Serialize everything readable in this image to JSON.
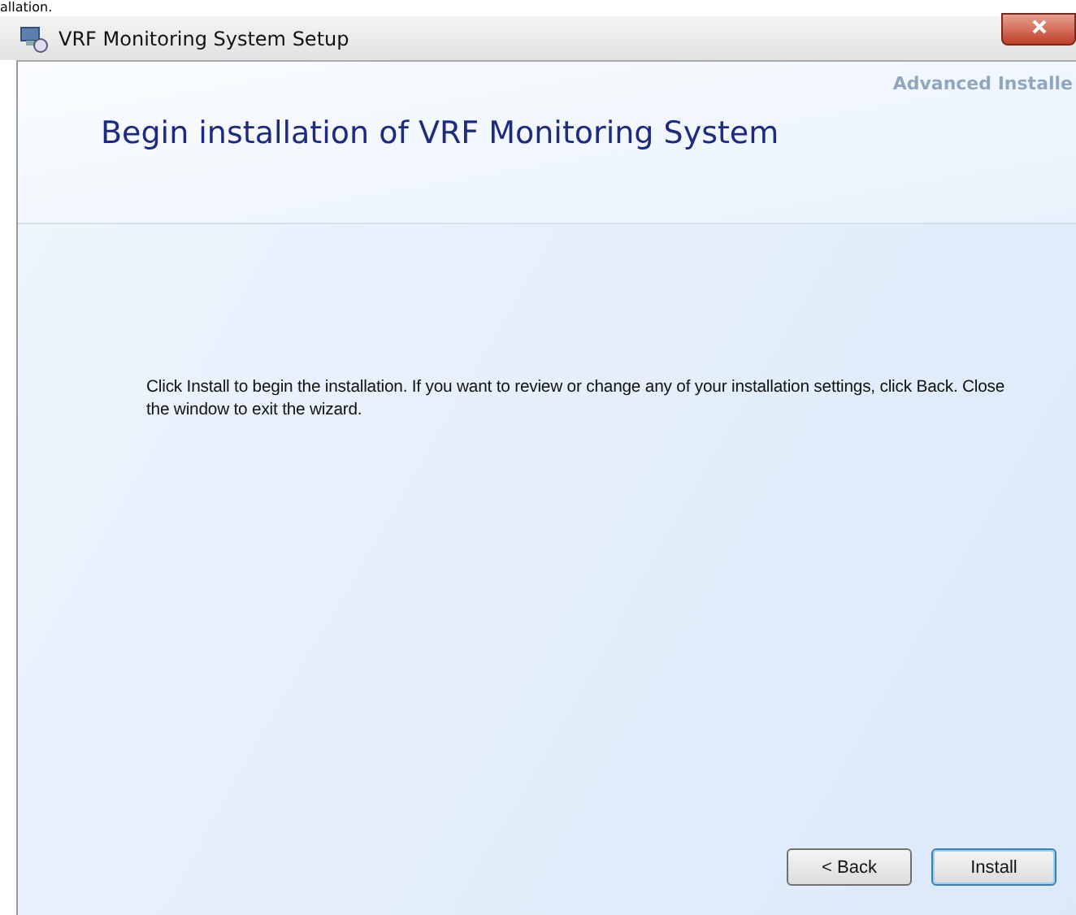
{
  "top_fragment": "allation.",
  "window": {
    "title": "VRF Monitoring System Setup"
  },
  "header": {
    "brand": "Advanced Installe",
    "heading": "Begin installation of VRF Monitoring System"
  },
  "body": {
    "text": "Click Install to begin the installation.  If you want to review or change any of your installation settings, click Back.  Close the window to exit the wizard."
  },
  "buttons": [
    {
      "label": "< Back",
      "default": false
    },
    {
      "label": "Install",
      "default": true
    }
  ]
}
